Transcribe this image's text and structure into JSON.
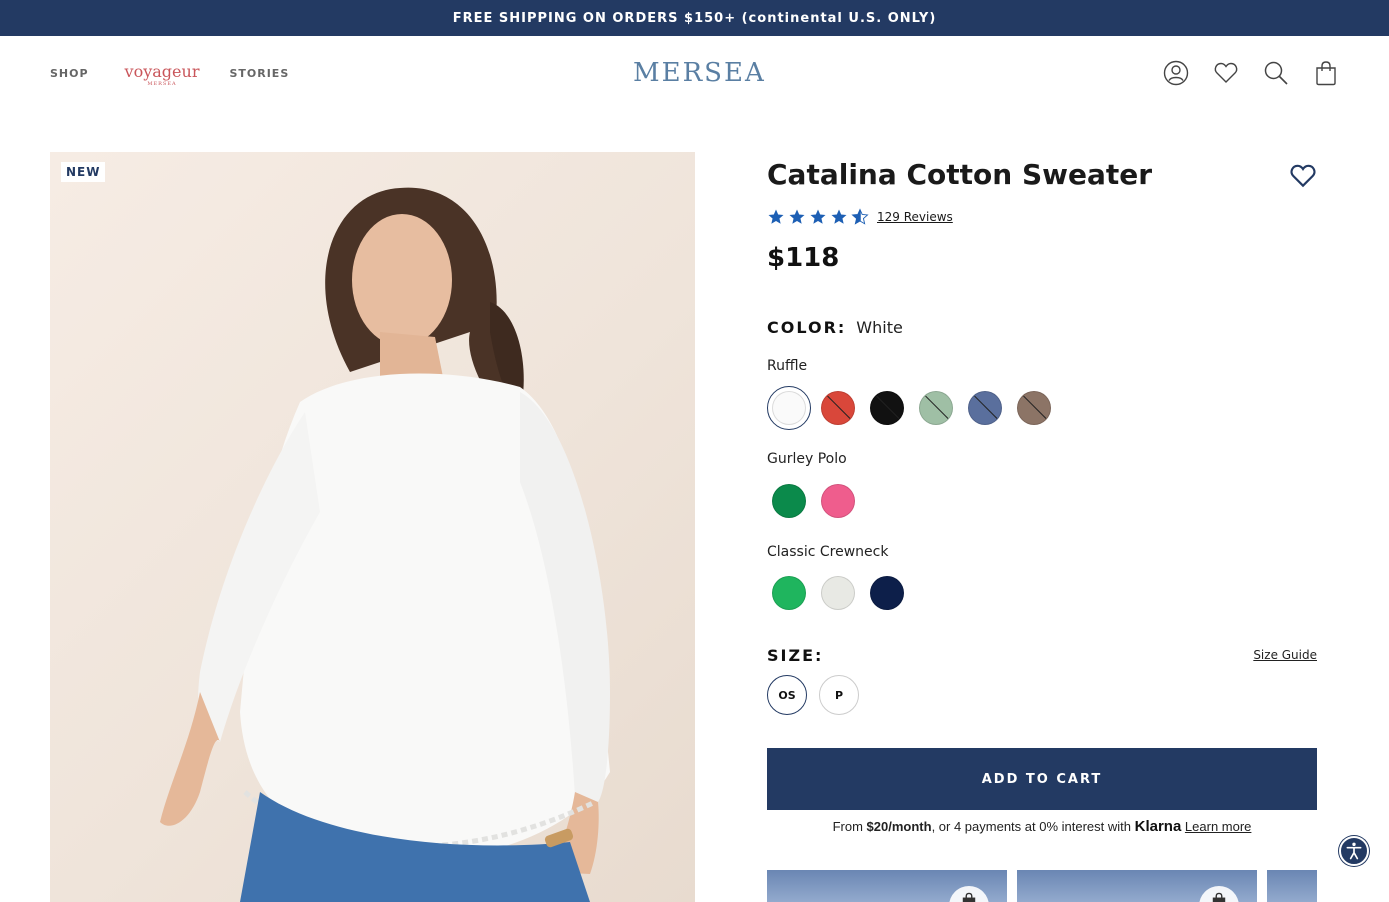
{
  "promo": {
    "text": "FREE SHIPPING ON ORDERS $150+ (continental U.S. ONLY)"
  },
  "nav": {
    "shop": "SHOP",
    "voyageur": "voyageur",
    "voyageur_sub": "MERSEA",
    "stories": "STORIES"
  },
  "brand": {
    "logo": "MERSEA"
  },
  "header_icons": [
    "account-icon",
    "wishlist-icon",
    "search-icon",
    "cart-icon"
  ],
  "product": {
    "badge": "NEW",
    "title": "Catalina Cotton Sweater",
    "rating": 4.5,
    "reviews": "129 Reviews",
    "price": "$118",
    "color_heading": "COLOR:",
    "color_value": "White",
    "groups": [
      {
        "name": "Ruffle",
        "swatches": [
          {
            "color": "#fafafa",
            "oos": false,
            "selected": true
          },
          {
            "color": "#d9473a",
            "oos": true,
            "selected": false
          },
          {
            "color": "#111111",
            "oos": true,
            "selected": false
          },
          {
            "color": "#9fbfa5",
            "oos": true,
            "selected": false
          },
          {
            "color": "#5a6f9d",
            "oos": true,
            "selected": false
          },
          {
            "color": "#8c7466",
            "oos": true,
            "selected": false
          }
        ]
      },
      {
        "name": "Gurley Polo",
        "swatches": [
          {
            "color": "#0b8a4b",
            "oos": false,
            "selected": false
          },
          {
            "color": "#ef5d8d",
            "oos": false,
            "selected": false
          }
        ]
      },
      {
        "name": "Classic Crewneck",
        "swatches": [
          {
            "color": "#1fb55e",
            "oos": false,
            "selected": false
          },
          {
            "color": "#e8e9e4",
            "oos": false,
            "selected": false
          },
          {
            "color": "#0d1f4a",
            "oos": false,
            "selected": false
          }
        ]
      }
    ],
    "size_heading": "SIZE:",
    "size_guide": "Size Guide",
    "sizes": [
      "OS",
      "P"
    ],
    "selected_size": "OS",
    "add_to_cart": "ADD TO CART",
    "klarna": {
      "prefix": "From ",
      "amount": "$20/month",
      "middle": ", or 4 payments at 0% interest with ",
      "logo": "Klarna",
      "link": "Learn more"
    }
  },
  "colors": {
    "accent": "#233a63",
    "star": "#1d5fb4"
  }
}
